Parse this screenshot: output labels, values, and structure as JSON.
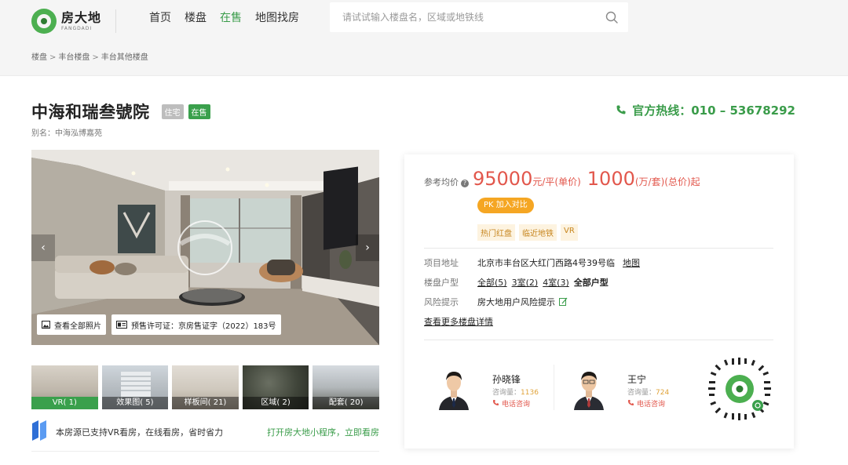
{
  "brand": {
    "name": "房大地",
    "sub": "FANGDADI"
  },
  "nav": [
    "首页",
    "楼盘",
    "在售",
    "地图找房"
  ],
  "nav_active": 2,
  "search": {
    "placeholder": "请试试输入楼盘名，区域或地铁线"
  },
  "breadcrumb": [
    "楼盘",
    "丰台楼盘",
    "丰台其他楼盘"
  ],
  "breadcrumb_sep": ">",
  "project": {
    "title": "中海和瑞叁號院",
    "type_tag": "住宅",
    "status_tag": "在售",
    "alias": "别名：中海泓博嘉苑"
  },
  "hotline": "官方热线：010 – 53678292",
  "gallery": {
    "photos_button": "查看全部照片",
    "permit": "预售许可证：京房售证字（2022）183号",
    "prev": "‹",
    "next": "›"
  },
  "thumbs": [
    {
      "label": "VR( 1)"
    },
    {
      "label": "效果图( 5)"
    },
    {
      "label": "样板间( 21)"
    },
    {
      "label": "区域( 2)"
    },
    {
      "label": "配套( 20)"
    }
  ],
  "vr_notice": {
    "text": "本房源已支持VR看房，在线看房，省时省力",
    "link": "打开房大地小程序，立即看房"
  },
  "price": {
    "label": "参考均价",
    "help": "?",
    "unit_price": "95000",
    "unit_price_unit": "元/平(单价)",
    "total_price": "1000",
    "total_price_unit": "(万/套)(总价)起"
  },
  "pk_button": "PK 加入对比",
  "feature_tags": [
    "热门红盘",
    "临近地铁",
    "VR"
  ],
  "info": {
    "address_label": "项目地址",
    "address": "北京市丰台区大红门西路4号39号临",
    "map_link": "地图",
    "layout_label": "楼盘户型",
    "layouts": [
      "全部(5)",
      "3室(2)",
      "4室(3)"
    ],
    "all_layouts": "全部户型",
    "risk_label": "风险提示",
    "risk": "房大地用户风险提示",
    "more": "查看更多楼盘详情"
  },
  "agents": [
    {
      "name": "孙晓锋",
      "count_label": "咨询量：",
      "count": "1136",
      "call": "电话咨询"
    },
    {
      "name": "王宁",
      "count_label": "咨询量：",
      "count": "724",
      "call": "电话咨询"
    }
  ],
  "colors": {
    "brand_green": "#3a9c4a",
    "price_red": "#e2574c",
    "pk_orange": "#f5a623"
  }
}
